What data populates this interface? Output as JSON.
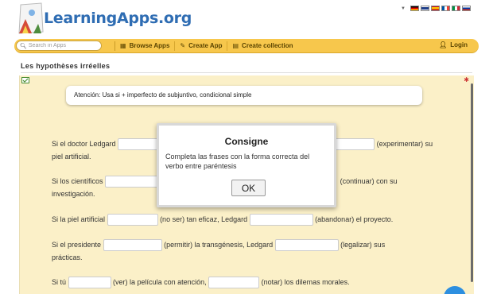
{
  "header": {
    "logo_text": "LearningApps.org",
    "flags": [
      "flag-de-icon",
      "flag-gb-icon",
      "flag-es-icon",
      "flag-fr-icon",
      "flag-it-icon",
      "flag-ru-icon"
    ]
  },
  "nav": {
    "search_placeholder": "Search in Apps",
    "browse_label": "Browse Apps",
    "create_label": "Create App",
    "collection_label": "Create collection",
    "login_label": "Login"
  },
  "page": {
    "title": "Les hypothèses irréelles"
  },
  "app": {
    "task": "Atención: Usa si + imperfecto de subjuntivo, condicional simple",
    "sentences": [
      {
        "a": "Si el doctor Ledgard",
        "b": "(experimentar) su",
        "c": "piel artificial."
      },
      {
        "a": "Si los científicos",
        "b": "(continuar) con su",
        "c": "investigación."
      },
      {
        "a": "Si la piel artificial",
        "b": "(no ser) tan eficaz, Ledgard",
        "c": "(abandonar) el proyecto."
      },
      {
        "a": "Si el presidente",
        "b": "(permitir) la transgénesis, Ledgard",
        "c": "(legalizar) sus",
        "d": "prácticas."
      },
      {
        "a": "Si tú",
        "b": "(ver) la película con atención,",
        "c": "(notar) los dilemas morales."
      }
    ]
  },
  "modal": {
    "title": "Consigne",
    "text": "Completa las frases con la forma correcta del verbo entre paréntesis",
    "ok_label": "OK"
  },
  "colors": {
    "navbar": "#f7c74c",
    "app_bg": "#fbf0c8",
    "logo": "#2f6db3"
  }
}
